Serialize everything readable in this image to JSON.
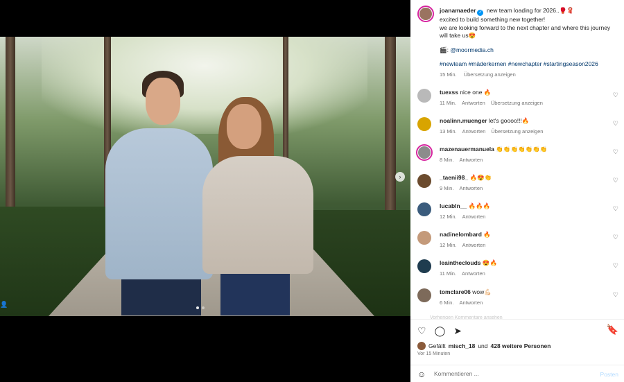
{
  "post": {
    "next_icon": "›",
    "user_tag_icon": "👤"
  },
  "caption": {
    "username": "joanamaeder",
    "verified_glyph": "✓",
    "line1": "new team loading for 2026..🥊🧣",
    "line2": "excited to build something new together!",
    "line3": "we are looking forward to the next chapter and where this journey will take us😍",
    "credit_icon": "🎬:",
    "credit_link": "@moormedia.ch",
    "hashtags": "#newteam #mäderkernen #newchapter #startingseason2026",
    "time": "15 Min.",
    "translate": "Übersetzung anzeigen"
  },
  "comments": [
    {
      "user": "tuexss",
      "text": "nice one 🔥",
      "time": "11 Min.",
      "reply": "Antworten",
      "translate": "Übersetzung anzeigen",
      "avatar_color": "#b9b9b9"
    },
    {
      "user": "noalinn.muenger",
      "text": "let's goooo!!!🔥",
      "time": "13 Min.",
      "reply": "Antworten",
      "translate": "Übersetzung anzeigen",
      "avatar_color": "#d8a400"
    },
    {
      "user": "mazenauermanuela",
      "text": "👏👏👏👏👏👏👏",
      "time": "8 Min.",
      "reply": "Antworten",
      "avatar_color": "#8c8c8c"
    },
    {
      "user": "_taenii98_",
      "text": "🔥😍👏",
      "time": "9 Min.",
      "reply": "Antworten",
      "avatar_color": "#6b4b2e"
    },
    {
      "user": "lucabln__",
      "text": "🔥🔥🔥",
      "time": "12 Min.",
      "reply": "Antworten",
      "avatar_color": "#3b5c7d"
    },
    {
      "user": "nadinelombard",
      "text": "🔥",
      "time": "12 Min.",
      "reply": "Antworten",
      "avatar_color": "#c49a7a"
    },
    {
      "user": "leaintheclouds",
      "text": "😍🔥",
      "time": "11 Min.",
      "reply": "Antworten",
      "avatar_color": "#1f3c4f"
    },
    {
      "user": "tomclare06",
      "text": "wow💪🏻",
      "time": "6 Min.",
      "reply": "Antworten",
      "avatar_color": "#7d6a5a"
    }
  ],
  "more_comments": "Vorherigen Kommentare ansehen",
  "actions": {
    "like_icon": "♡",
    "comment_icon": "◯",
    "share_icon": "➤",
    "bookmark_icon": "🔖",
    "likes_prefix": "Gefällt",
    "likes_user": "misch_18",
    "likes_middle": "und",
    "likes_count": "428 weitere Personen",
    "time": "Vor 15 Minuten"
  },
  "comment_box": {
    "emoji_icon": "☺",
    "placeholder": "Kommentieren ...",
    "post_label": "Posten"
  },
  "heart_icon": "♡"
}
